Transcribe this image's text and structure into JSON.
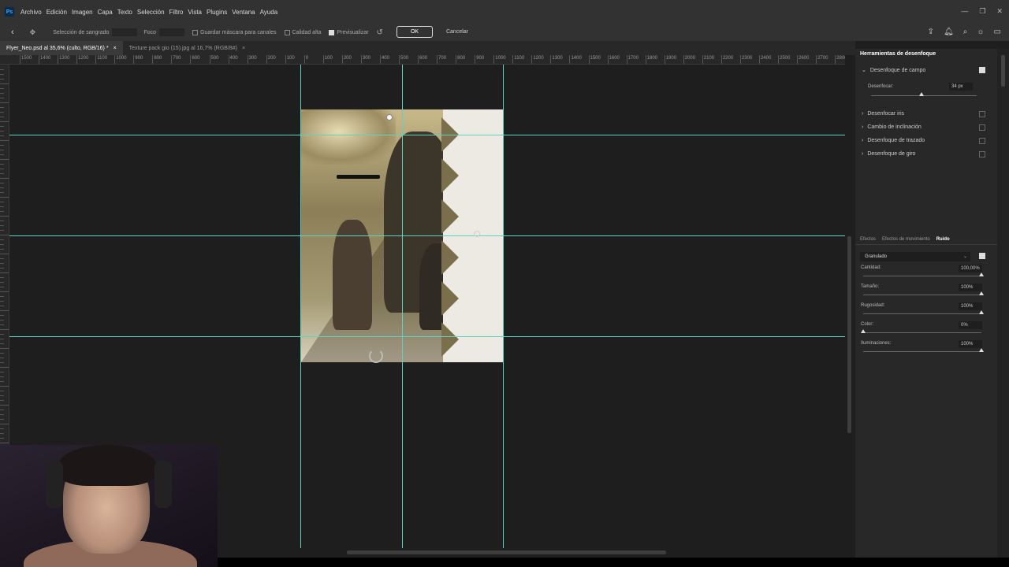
{
  "app": {
    "logo": "Ps"
  },
  "menu": [
    "Archivo",
    "Edición",
    "Imagen",
    "Capa",
    "Texto",
    "Selección",
    "Filtro",
    "Vista",
    "Plugins",
    "Ventana",
    "Ayuda"
  ],
  "options": {
    "seleccion_sangrado": "Selección de sangrado",
    "foco": "Foco",
    "guardar_mascara": "Guardar máscara para canales",
    "calidad_alta": "Calidad alta",
    "previsualizar": "Previsualizar",
    "ok": "OK",
    "cancelar": "Cancelar"
  },
  "tabs": [
    {
      "label": "Flyer_Neo.psd al 35,6% (culto, RGB/16) *",
      "active": true
    },
    {
      "label": "Texture pack gio (15).jpg al 16,7% (RGB/8#)",
      "active": false
    }
  ],
  "ruler_h": [
    "1500",
    "1400",
    "1300",
    "1200",
    "1100",
    "1000",
    "900",
    "800",
    "700",
    "600",
    "500",
    "400",
    "300",
    "200",
    "100",
    "0",
    "100",
    "200",
    "300",
    "400",
    "500",
    "600",
    "700",
    "800",
    "900",
    "1000",
    "1100",
    "1200",
    "1300",
    "1400",
    "1500",
    "1600",
    "1700",
    "1800",
    "1900",
    "2000",
    "2100",
    "2200",
    "2300",
    "2400",
    "2500",
    "2600",
    "2700",
    "2800"
  ],
  "blur_panel": {
    "title": "Herramientas de desenfoque",
    "campo": "Desenfoque de campo",
    "desenfocar_label": "Desenfocar:",
    "desenfocar_value": "34 px",
    "desenfocar_level": 0.48,
    "iris": "Desenfocar iris",
    "inclinacion": "Cambio de inclinación",
    "trazado": "Desenfoque de trazado",
    "giro": "Desenfoque de giro"
  },
  "effects_panel": {
    "tabs": [
      "Efectos",
      "Efectos de movimiento",
      "Ruido"
    ],
    "active_tab": "Ruido",
    "type": "Granulado",
    "rows": [
      {
        "label": "Cantidad:",
        "value": "100,00%",
        "level": 1.0
      },
      {
        "label": "Tamaño:",
        "value": "100%",
        "level": 1.0
      },
      {
        "label": "Rugosidad:",
        "value": "100%",
        "level": 1.0
      },
      {
        "label": "Color:",
        "value": "0%",
        "level": 0.0
      },
      {
        "label": "Iluminaciones:",
        "value": "100%",
        "level": 1.0
      }
    ]
  },
  "colors": {
    "guide": "#5fd3c2",
    "panel_bg": "#282828",
    "canvas_bg": "#1e1e1e",
    "accent": "#31a8ff"
  }
}
